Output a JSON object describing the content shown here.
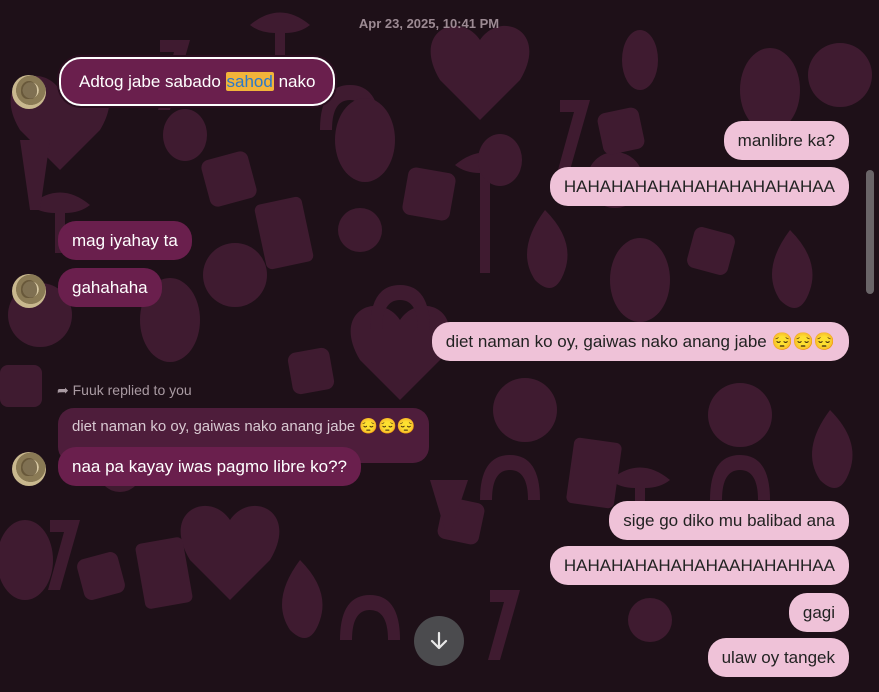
{
  "timestamp": "Apr 23, 2025, 10:41 PM",
  "messages": {
    "m1_before": "Adtog jabe sabado ",
    "m1_highlight": "sahod",
    "m1_after": " nako",
    "m2": "manlibre ka?",
    "m3": "HAHAHAHAHAHAHAHAHAHAHAA",
    "m4": "mag iyahay ta",
    "m5": "gahahaha",
    "m6": "diet naman ko oy, gaiwas nako anang jabe 😔😔😔",
    "reply_label": "Fuuk replied to you",
    "reply_quote": "diet naman ko oy, gaiwas nako anang jabe 😔😔😔",
    "m7": "naa pa kayay iwas pagmo libre ko??",
    "m8": "sige go diko mu balibad ana",
    "m9": "HAHAHAHAHAHAHAAHAHAHHAA",
    "m10": "gagi",
    "m11": "ulaw oy tangek"
  },
  "icons": {
    "scroll_down": "arrow-down-icon",
    "reply": "reply-arrow-icon",
    "avatar": "contact-avatar"
  },
  "colors": {
    "background": "#1e1018",
    "incoming_bubble": "#6a1f4d",
    "outgoing_bubble": "#efc2d8",
    "highlight": "#f2b43a"
  }
}
